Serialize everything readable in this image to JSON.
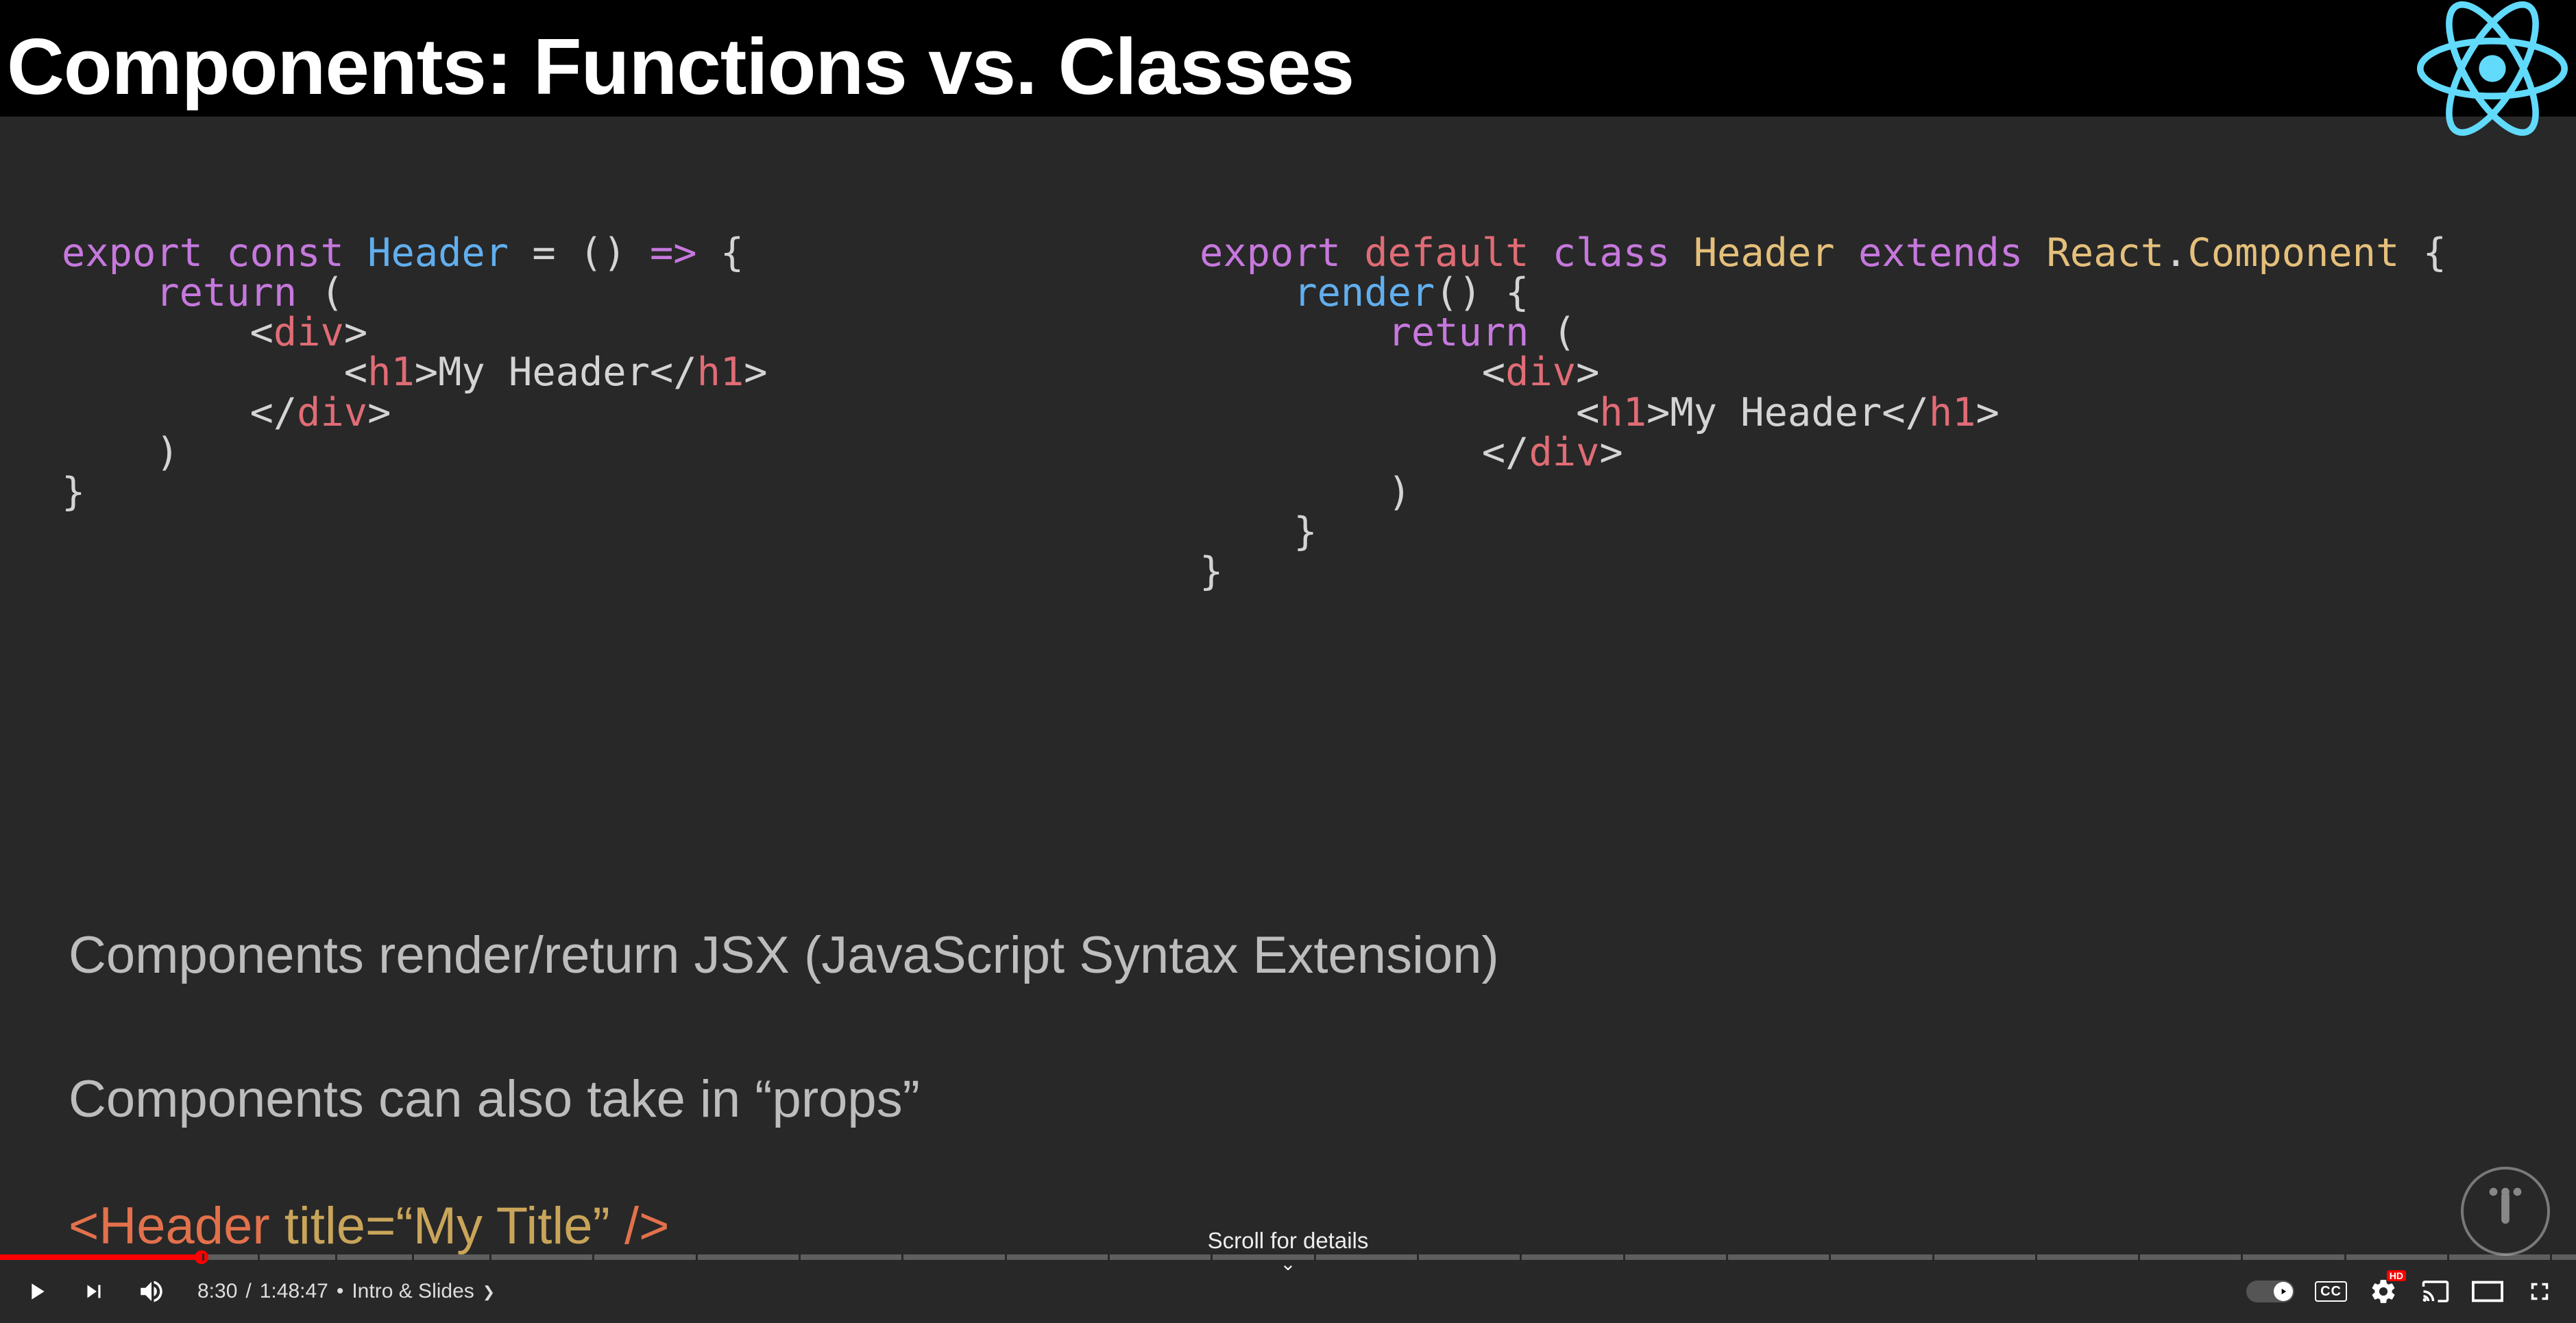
{
  "slide": {
    "title": "Components: Functions vs. Classes",
    "function_code": "export const Header = () => {\n    return (\n        <div>\n            <h1>My Header</h1>\n        </div>\n    )\n}",
    "class_code": "export default class Header extends React.Component {\n    render() {\n        return (\n            <div>\n                <h1>My Header</h1>\n            </div>\n        )\n    }\n}",
    "text_line_1": "Components render/return JSX (JavaScript Syntax Extension)",
    "text_line_2": "Components can also take in “props”",
    "jsx_example": {
      "open": "<Header",
      "attr": " title=“My Title” ",
      "close": "/>"
    },
    "logo_color": "#61dafb"
  },
  "scroll_hint": "Scroll for details",
  "player": {
    "current_time": "8:30",
    "duration": "1:48:47",
    "chapter_name": "Intro & Slides",
    "progress_percent": 7.82,
    "hd_label": "HD",
    "cc_label": "CC"
  }
}
